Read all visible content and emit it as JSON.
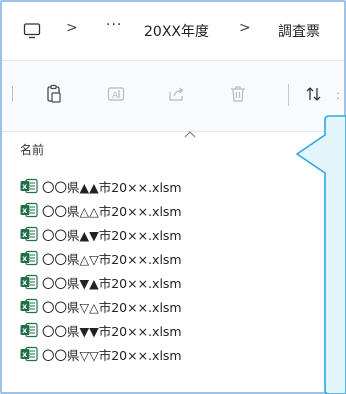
{
  "breadcrumb": {
    "sep1": ">",
    "more": "···",
    "folder1": "20XX年度",
    "sep2": ">",
    "folder2": "調査票"
  },
  "list": {
    "column_header": "名前",
    "files": [
      "〇〇県▲▲市20××.xlsm",
      "〇〇県△△市20××.xlsm",
      "〇〇県▲▼市20××.xlsm",
      "〇〇県△▽市20××.xlsm",
      "〇〇県▼▲市20××.xlsm",
      "〇〇県▽△市20××.xlsm",
      "〇〇県▼▼市20××.xlsm",
      "〇〇県▽▽市20××.xlsm"
    ]
  },
  "colors": {
    "frame_border": "#9cc2e8",
    "callout_fill": "#e3f4fb",
    "callout_stroke": "#2fa6e0",
    "excel_green": "#1e7145"
  }
}
